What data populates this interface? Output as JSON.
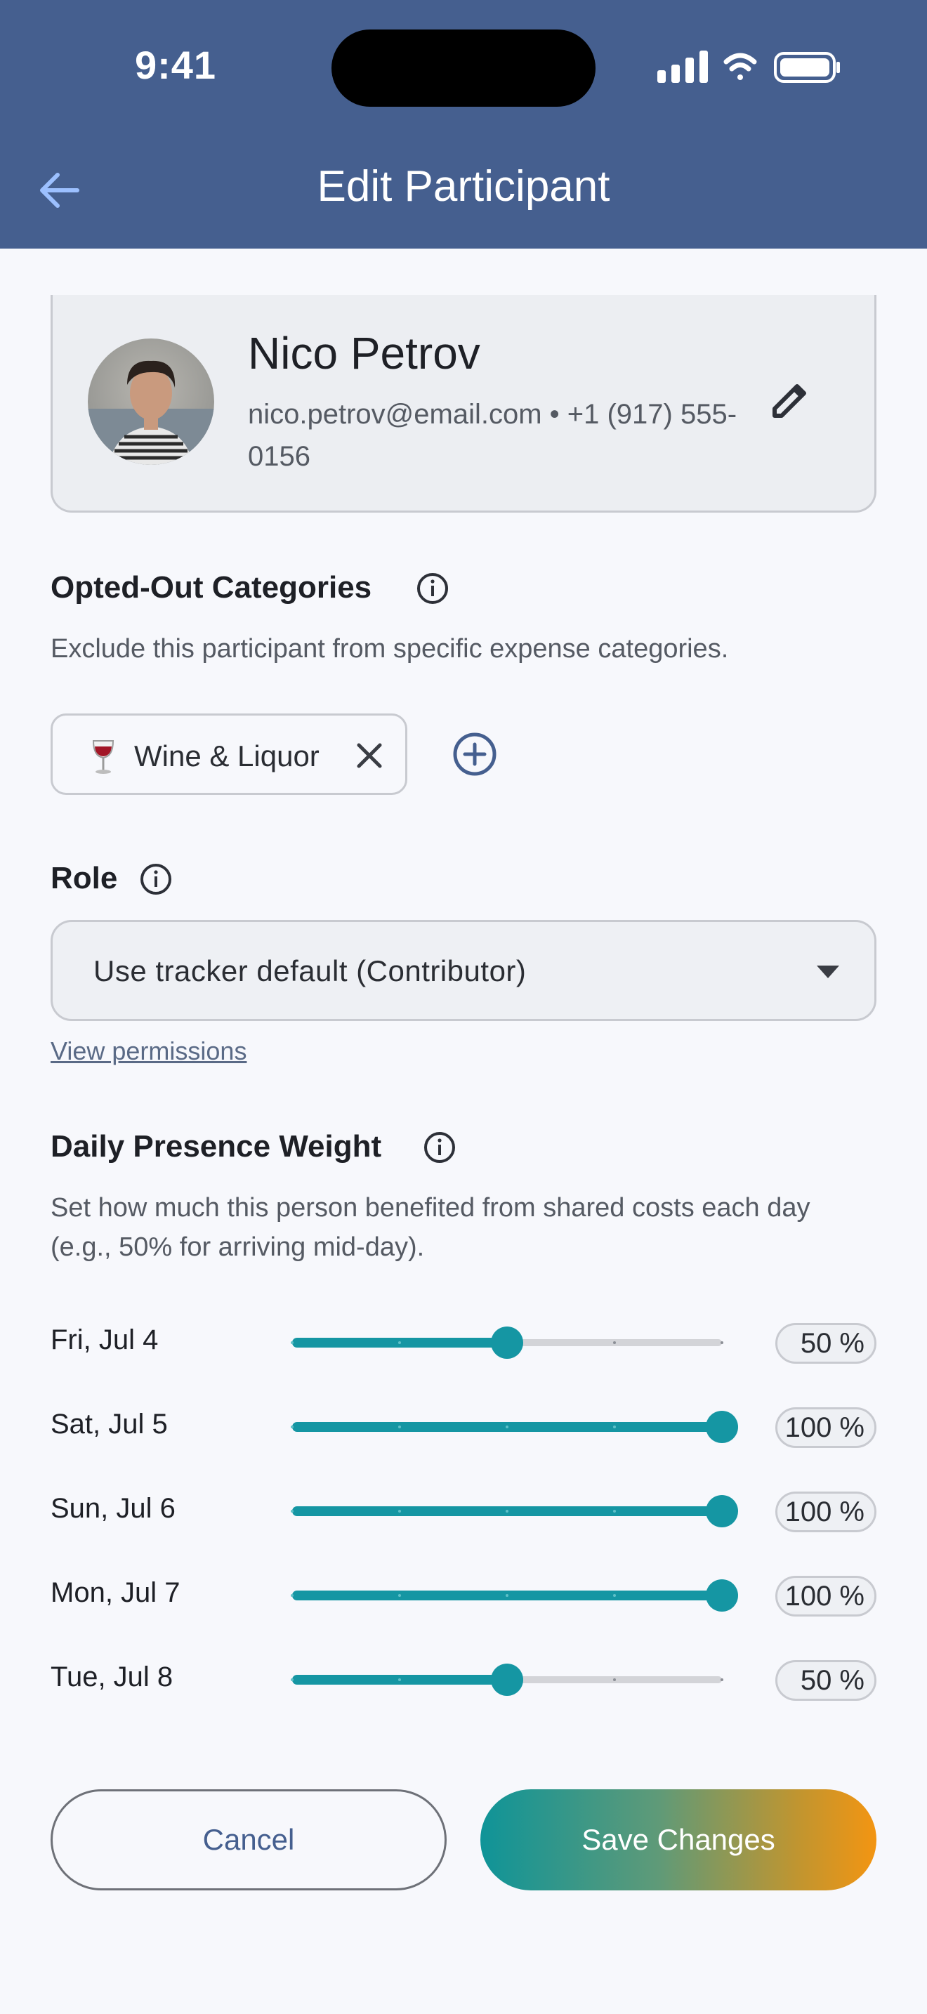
{
  "status_bar": {
    "time": "9:41"
  },
  "header": {
    "title": "Edit Participant"
  },
  "profile": {
    "name": "Nico Petrov",
    "contact": "nico.petrov@email.com • +1 (917) 555-0156"
  },
  "opted_out": {
    "title": "Opted-Out Categories",
    "description": "Exclude this participant from specific expense categories.",
    "chips": [
      {
        "label": "Wine & Liquor",
        "icon": "wine-glass-icon"
      }
    ]
  },
  "role": {
    "title": "Role",
    "selected": "Use tracker default (Contributor)",
    "link": "View permissions"
  },
  "presence": {
    "title": "Daily Presence Weight",
    "description": "Set how much this person benefited from shared costs each day (e.g., 50% for arriving mid-day).",
    "days": [
      {
        "label": "Fri, Jul 4",
        "value": 50,
        "display": "50 %"
      },
      {
        "label": "Sat, Jul 5",
        "value": 100,
        "display": "100 %"
      },
      {
        "label": "Sun, Jul 6",
        "value": 100,
        "display": "100 %"
      },
      {
        "label": "Mon, Jul 7",
        "value": 100,
        "display": "100 %"
      },
      {
        "label": "Tue, Jul 8",
        "value": 50,
        "display": "50 %"
      }
    ]
  },
  "actions": {
    "cancel": "Cancel",
    "save": "Save Changes"
  },
  "colors": {
    "header_bg": "#455f8f",
    "accent_teal": "#1596a3",
    "save_gradient_start": "#0f9498",
    "save_gradient_end": "#f39512"
  }
}
